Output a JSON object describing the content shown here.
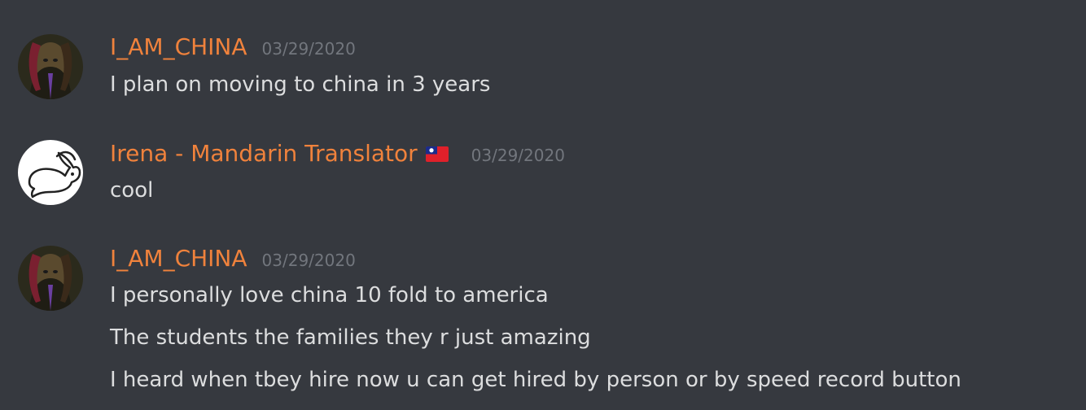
{
  "colors": {
    "background": "#36393f",
    "username": "#f0823c",
    "timestamp": "#72767d",
    "message_text": "#dcddde"
  },
  "messages": [
    {
      "author": "I_AM_CHINA",
      "timestamp": "03/29/2020",
      "avatar_icon": "dark-portrait-avatar",
      "lines": [
        "I plan on moving to china in 3 years"
      ]
    },
    {
      "author": "Irena - Mandarin Translator",
      "flag_icon": "taiwan-flag-icon",
      "timestamp": "03/29/2020",
      "avatar_icon": "rabbit-avatar",
      "lines": [
        "cool"
      ]
    },
    {
      "author": "I_AM_CHINA",
      "timestamp": "03/29/2020",
      "avatar_icon": "dark-portrait-avatar",
      "lines": [
        "I personally love china 10 fold to america",
        "The students the families they r just amazing",
        "I heard when tbey hire now u can get hired by person or by speed record button"
      ]
    }
  ]
}
